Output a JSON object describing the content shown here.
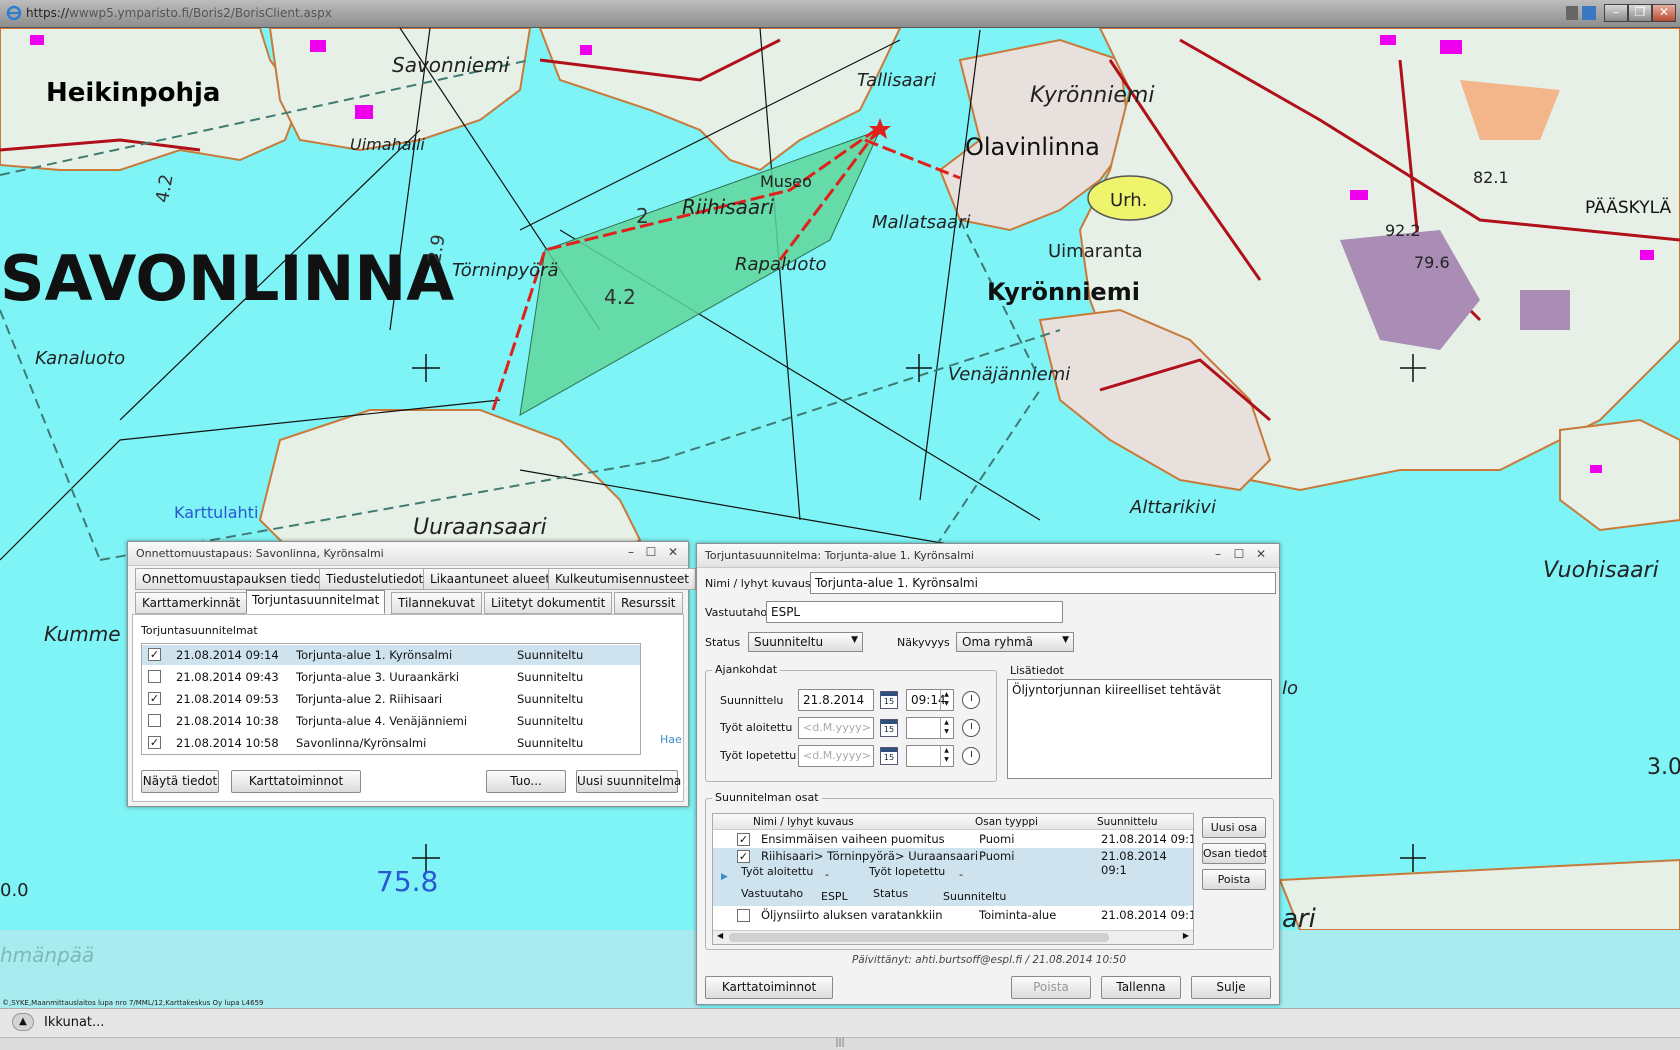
{
  "browser": {
    "url_prefix": "https://",
    "url_host": "wwwp5.ymparisto.fi",
    "url_path": "/Boris2/BorisClient.aspx"
  },
  "map": {
    "labels": {
      "heikinpohja": "Heikinpohja",
      "savonniemi": "Savonniemi",
      "uimahalli": "Uimahalli",
      "tallisaari": "Tallisaari",
      "kyronniemi_top": "Kyrönniemi",
      "olavinlinna": "Olavinlinna",
      "museo": "Museo",
      "riihisaari": "Riihisaari",
      "mallatsaari": "Mallatsaari",
      "urh": "Urh.",
      "num_82_1": "82.1",
      "paaskyla": "PÄÄSKYLÄ",
      "num_92_2": "92.2",
      "num_79_6": "79.6",
      "savonlinna": "SAVONLINNA",
      "torninpyora": "Törninpyörä",
      "rapaluoto": "Rapaluoto",
      "uimaranta": "Uimaranta",
      "kyronniemi": "Kyrönniemi",
      "num_4_2a": "4.2",
      "num_4_2b": "4.2",
      "num_2_9": "2.9",
      "num_2": "2",
      "kanaluoto": "Kanaluoto",
      "venajanniemi": "Venäjänniemi",
      "karttulahti": "Karttulahti",
      "uuraansaari": "Uuraansaari",
      "alttarikivi": "Alttarikivi",
      "vuohisaari": "Vuohisaari",
      "kumme": "Kumme",
      "num_75_8": "75.8",
      "num_0_0": "0.0",
      "hmanpaa": "hmänpää",
      "num_3_0": "3.0",
      "ari": "ari",
      "lo": "lo"
    },
    "copyright": "©,SYKE,Maanmittauslaitos lupa nro 7/MML/12,Karttakeskus Oy lupa L4659"
  },
  "incident_dialog": {
    "title": "Onnettomuustapaus: Savonlinna, Kyrönsalmi",
    "tabs_row1": [
      "Onnettomuustapauksen tiedot",
      "Tiedustelutiedot",
      "Likaantuneet alueet",
      "Kulkeutumisennusteet"
    ],
    "tabs_row2": [
      "Karttamerkinnät",
      "Torjuntasuunnitelmat",
      "Tilannekuvat",
      "Liitetyt dokumentit",
      "Resurssit"
    ],
    "section_label": "Torjuntasuunnitelmat",
    "plans": [
      {
        "date": "21.08.2014 09:14",
        "name": "Torjunta-alue 1. Kyrönsalmi",
        "status": "Suunniteltu",
        "checked": "✓"
      },
      {
        "date": "21.08.2014 09:43",
        "name": "Torjunta-alue 3. Uuraankärki",
        "status": "Suunniteltu",
        "checked": ""
      },
      {
        "date": "21.08.2014 09:53",
        "name": "Torjunta-alue 2. Riihisaari",
        "status": "Suunniteltu",
        "checked": "✓"
      },
      {
        "date": "21.08.2014 10:38",
        "name": "Torjunta-alue 4. Venäjänniemi",
        "status": "Suunniteltu",
        "checked": ""
      },
      {
        "date": "21.08.2014 10:58",
        "name": "Savonlinna/Kyrönsalmi",
        "status": "Suunniteltu",
        "checked": "✓"
      }
    ],
    "hae": "Hae",
    "buttons": {
      "show": "Näytä tiedot",
      "map": "Karttatoiminnot",
      "import": "Tuo...",
      "new": "Uusi suunnitelma"
    }
  },
  "plan_dialog": {
    "title": "Torjuntasuunnitelma: Torjunta-alue 1. Kyrönsalmi",
    "name_label": "Nimi / lyhyt kuvaus",
    "name_value": "Torjunta-alue 1. Kyrönsalmi",
    "resp_label": "Vastuutaho",
    "resp_value": "ESPL",
    "status_label": "Status",
    "status_value": "Suunniteltu",
    "visibility_label": "Näkyvyys",
    "visibility_value": "Oma ryhmä",
    "times_group": "Ajankohdat",
    "planned_label": "Suunnittelu",
    "planned_date": "21.8.2014",
    "planned_time": "09:14",
    "start_label": "Työt aloitettu",
    "end_label": "Työt lopetettu",
    "date_placeholder": "<d.M.yyyy>",
    "cal_num": "15",
    "extra_label": "Lisätiedot",
    "extra_text": "Öljyntorjunnan kiireelliset tehtävät",
    "parts_group": "Suunnitelman osat",
    "parts_headers": [
      "Nimi / lyhyt kuvaus",
      "Osan tyyppi",
      "Suunnittelu"
    ],
    "parts": [
      {
        "name": "Ensimmäisen vaiheen puomitus",
        "type": "Puomi",
        "date": "21.08.2014 09:1",
        "checked": "✓"
      },
      {
        "name": "Riihisaari> Törninpyörä> Uuraansaari",
        "type": "Puomi",
        "date": "21.08.2014 09:1",
        "checked": "✓"
      },
      {
        "name": "Öljynsiirto aluksen varatankkiin",
        "type": "Toiminta-alue",
        "date": "21.08.2014 09:1",
        "checked": ""
      }
    ],
    "detail": {
      "start_label": "Työt aloitettu",
      "start_val": "-",
      "end_label": "Työt lopetettu",
      "end_val": "-",
      "resp_label": "Vastuutaho",
      "resp_val": "ESPL",
      "status_label": "Status",
      "status_val": "Suunniteltu"
    },
    "part_buttons": {
      "new": "Uusi osa",
      "info": "Osan tiedot",
      "delete": "Poista"
    },
    "updated": "Päivittänyt: ahti.burtsoff@espl.fi / 21.08.2014 10:50",
    "buttons": {
      "map": "Karttatoiminnot",
      "delete": "Poista",
      "save": "Tallenna",
      "close": "Sulje"
    }
  },
  "taskbar": {
    "label": "Ikkunat...",
    "grip": "|||"
  }
}
